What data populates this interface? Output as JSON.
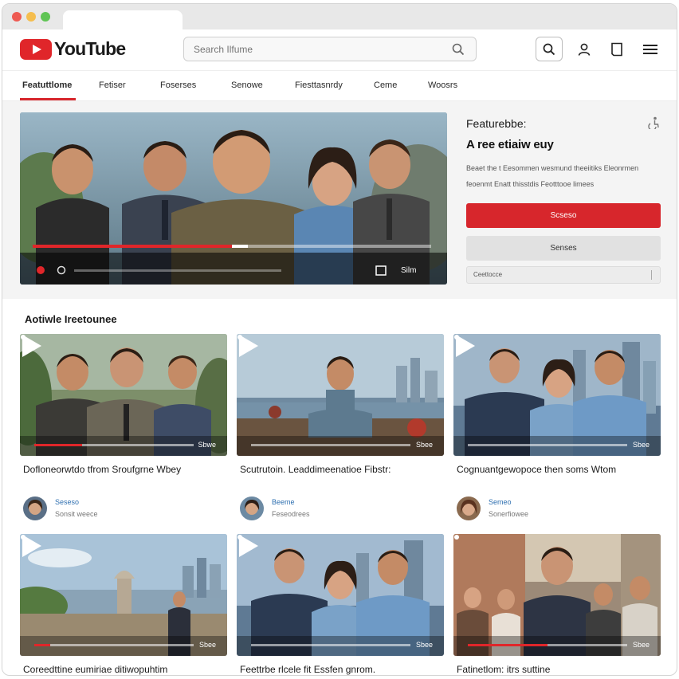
{
  "app": {
    "logo_text": "YouTube"
  },
  "search": {
    "placeholder": "Search Ilfume"
  },
  "nav": {
    "tabs": [
      {
        "label": "Featuttlome",
        "active": true
      },
      {
        "label": "Fetiser"
      },
      {
        "label": "Foserses"
      },
      {
        "label": "Senowe"
      },
      {
        "label": "Fiesttasnrdy"
      },
      {
        "label": "Ceme"
      },
      {
        "label": "Woosrs"
      }
    ]
  },
  "featured": {
    "eyebrow": "Featurebbe:",
    "title": "A ree etiaiw euy",
    "description": "Beaet the t Eesommen wesmund theeiitiks Eleonrmen feoenmt Enatt thisstdis Feotttooe limees",
    "primary_button": "Scseso",
    "secondary_button": "Senses",
    "select_value": "Ceettocce",
    "player": {
      "progress_fraction": 0.5,
      "buffer_fraction": 0.04,
      "duration": "Silm"
    }
  },
  "section": {
    "title": "Aotiwle Ireetounee"
  },
  "videos": [
    {
      "title": "Dofloneorwtdo tfrom Sroufgrne Wbey",
      "channel": "Seseso",
      "meta": "Sonsit weece",
      "duration": "Sbwe",
      "progress_fraction": 0.3
    },
    {
      "title": "Scutrutoin. Leaddimeenatioe Fibstr:",
      "channel": "Beeme",
      "meta": "Feseodrees",
      "duration": "Sbee",
      "progress_fraction": 0.0
    },
    {
      "title": "Cognuantgewopoce then soms Wtom",
      "channel": "Semeo",
      "meta": "Sonerfiowee",
      "duration": "Sbee",
      "progress_fraction": 0.0
    },
    {
      "title": "Coreedttine eumiriae ditiwopuhtim",
      "channel": "",
      "meta": "",
      "duration": "Sbee",
      "progress_fraction": 0.1
    },
    {
      "title": "Feettrbe rlcele fit Essfen gnrom.",
      "channel": "",
      "meta": "",
      "duration": "Sbee",
      "progress_fraction": 0.0
    },
    {
      "title": "Fatinetlom: itrs suttine",
      "channel": "",
      "meta": "",
      "duration": "Sbee",
      "progress_fraction": 0.5
    }
  ],
  "colors": {
    "accent": "#d7262c",
    "text": "#1a1a1a",
    "link": "#2e6fb0"
  }
}
